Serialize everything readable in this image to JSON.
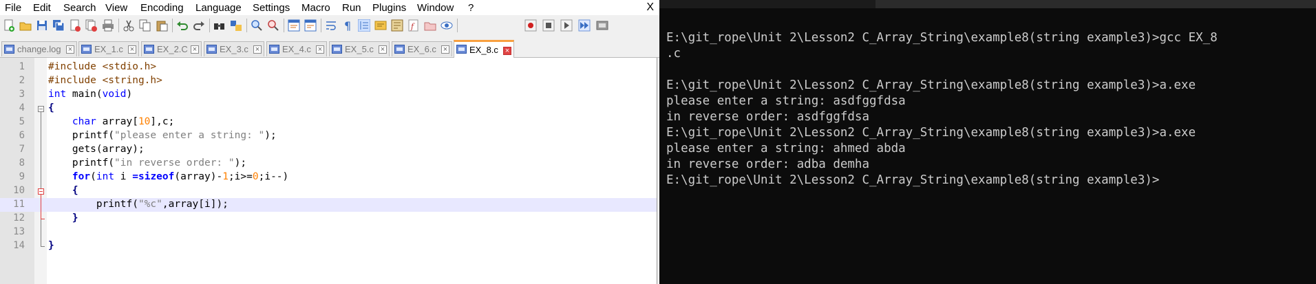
{
  "menu": [
    "File",
    "Edit",
    "Search",
    "View",
    "Encoding",
    "Language",
    "Settings",
    "Macro",
    "Run",
    "Plugins",
    "Window",
    "?"
  ],
  "menu_close": "X",
  "tabs": [
    "change.log",
    "EX_1.c",
    "EX_2.C",
    "EX_3.c",
    "EX_4.c",
    "EX_5.c",
    "EX_6.c",
    "EX_8.c"
  ],
  "active_tab": "EX_8.c",
  "editor_lines": [
    "1",
    "2",
    "3",
    "4",
    "5",
    "6",
    "7",
    "8",
    "9",
    "10",
    "11",
    "12",
    "13",
    "14"
  ],
  "code": {
    "l1": "#include <stdio.h>",
    "l2": "#include <string.h>",
    "l3a": "int",
    "l3b": " main(",
    "l3c": "void",
    "l3d": ")",
    "l4": "{",
    "l5a": "    ",
    "l5b": "char",
    "l5c": " array[",
    "l5d": "10",
    "l5e": "],c;",
    "l6a": "    printf(",
    "l6b": "\"please enter a string: \"",
    "l6c": ");",
    "l7": "    gets(array);",
    "l8a": "    printf(",
    "l8b": "\"in reverse order: \"",
    "l8c": ");",
    "l9a": "    ",
    "l9b": "for",
    "l9c": "(",
    "l9d": "int",
    "l9e": " i ",
    "l9f": "=sizeof",
    "l9g": "(array)-",
    "l9h": "1",
    "l9i": ";i>=",
    "l9j": "0",
    "l9k": ";i--)",
    "l10": "    {",
    "l11a": "        printf(",
    "l11b": "\"%c\"",
    "l11c": ",array[i]);",
    "l12": "    }",
    "l13": "",
    "l14": "}"
  },
  "console": {
    "lines": [
      "E:\\git_rope\\Unit 2\\Lesson2 C_Array_String\\example8(string example3)>gcc EX_8",
      ".c",
      "",
      "E:\\git_rope\\Unit 2\\Lesson2 C_Array_String\\example8(string example3)>a.exe",
      "please enter a string: asdfggfdsa",
      "in reverse order: asdfggfdsa",
      "E:\\git_rope\\Unit 2\\Lesson2 C_Array_String\\example8(string example3)>a.exe",
      "please enter a string: ahmed abda",
      "in reverse order: adba demha",
      "E:\\git_rope\\Unit 2\\Lesson2 C_Array_String\\example8(string example3)>"
    ]
  },
  "colors": {
    "keyword": "#0000ff",
    "preprocessor": "#804000",
    "string": "#808080",
    "number": "#ff8000",
    "active_tab_accent": "#f9a03f",
    "current_line": "#e8e8ff",
    "console_bg": "#0c0c0c",
    "console_text": "#cccccc"
  },
  "toolbar_icons": [
    "new-icon",
    "open-icon",
    "save-icon",
    "save-all-icon",
    "close-icon",
    "close-all-icon",
    "print-icon",
    "cut-icon",
    "copy-icon",
    "paste-icon",
    "undo-icon",
    "redo-icon",
    "find-icon",
    "replace-icon",
    "zoom-in-icon",
    "zoom-out-icon",
    "sync-v-icon",
    "sync-h-icon",
    "wrap-icon",
    "all-chars-icon",
    "indent-guide-icon",
    "udl-icon",
    "doc-map-icon",
    "function-list-icon",
    "folder-workspace-icon",
    "monitor-icon",
    "record-icon",
    "stop-icon",
    "play-icon",
    "play-multiple-icon",
    "save-macro-icon"
  ]
}
